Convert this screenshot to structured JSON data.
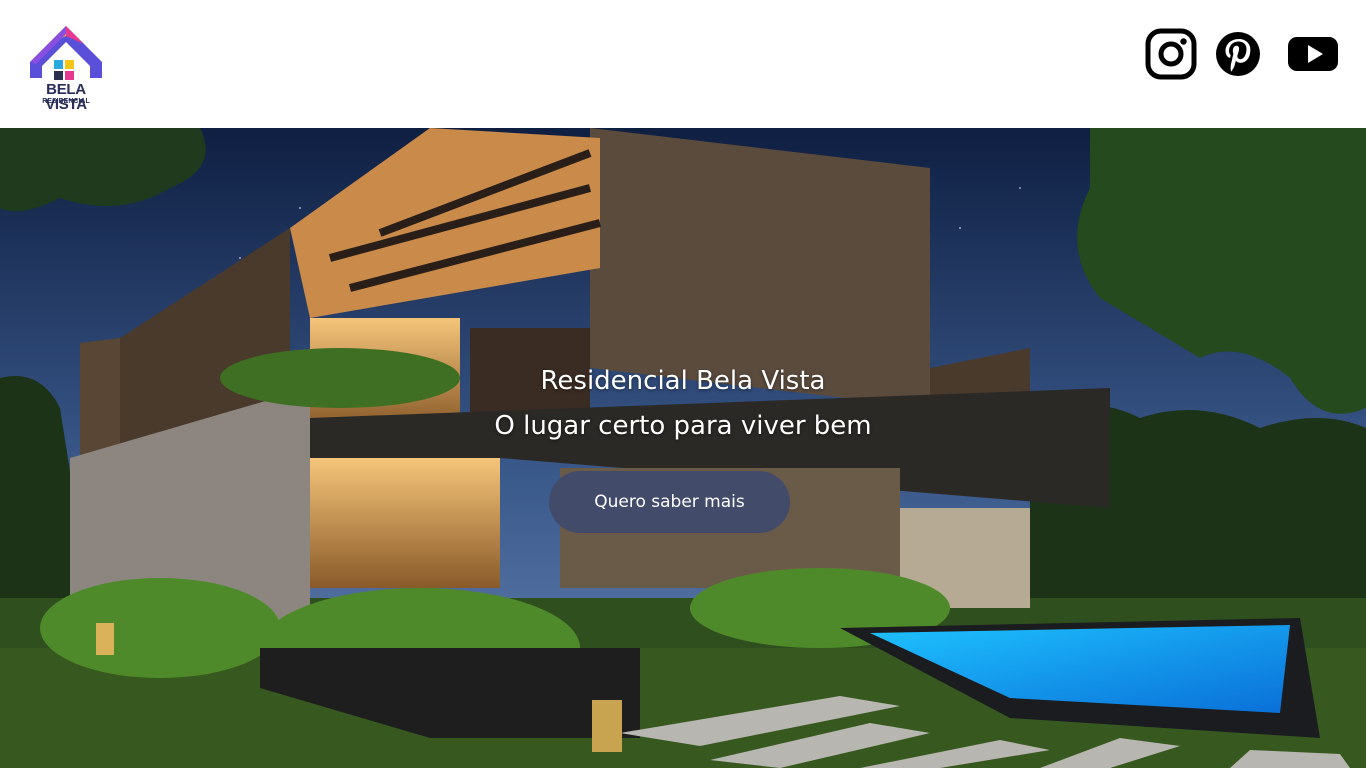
{
  "header": {
    "logo": {
      "name": "BELA VISTA",
      "subtitle": "RESIDENCIAL"
    },
    "social": [
      {
        "icon": "instagram-icon"
      },
      {
        "icon": "pinterest-icon"
      },
      {
        "icon": "youtube-icon"
      }
    ]
  },
  "hero": {
    "title_line1": "Residencial Bela Vista",
    "title_line2": "O lugar certo para viver bem",
    "cta_label": "Quero saber mais"
  },
  "colors": {
    "cta_background": "#434b6b",
    "logo_text": "#2a2f5a"
  }
}
